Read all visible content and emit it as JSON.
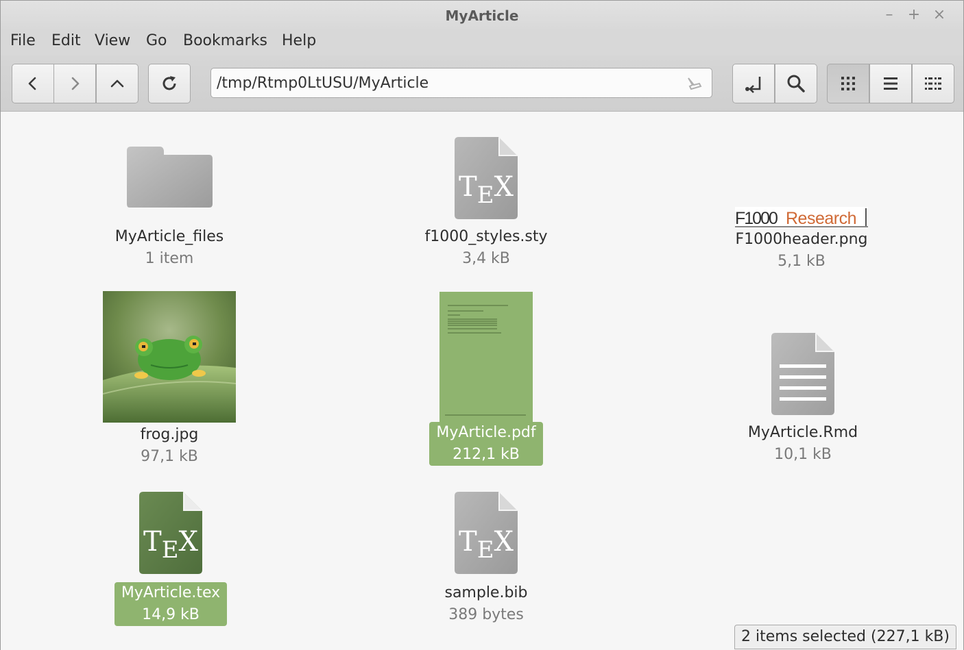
{
  "window": {
    "title": "MyArticle",
    "minimize_glyph": "–",
    "maximize_glyph": "+",
    "close_glyph": "×"
  },
  "menu": [
    "File",
    "Edit",
    "View",
    "Go",
    "Bookmarks",
    "Help"
  ],
  "location": {
    "path": "/tmp/Rtmp0LtUSU/MyArticle"
  },
  "colors": {
    "selection": "#8fb46f",
    "icon_gray": "#a8a8a8",
    "tex_selected": "#5b7b46"
  },
  "files": [
    {
      "name": "MyArticle_files",
      "detail": "1 item",
      "icon": "folder-icon",
      "selected": false
    },
    {
      "name": "f1000_styles.sty",
      "detail": "3,4 kB",
      "icon": "tex-file-icon",
      "selected": false
    },
    {
      "name": "F1000header.png",
      "detail": "5,1 kB",
      "icon": "image-thumbnail",
      "selected": false,
      "thumbnail_text": "F1000Research"
    },
    {
      "name": "frog.jpg",
      "detail": "97,1 kB",
      "icon": "image-thumbnail",
      "selected": false
    },
    {
      "name": "MyArticle.pdf",
      "detail": "212,1 kB",
      "icon": "pdf-thumbnail",
      "selected": true
    },
    {
      "name": "MyArticle.Rmd",
      "detail": "10,1 kB",
      "icon": "text-file-icon",
      "selected": false
    },
    {
      "name": "MyArticle.tex",
      "detail": "14,9 kB",
      "icon": "tex-file-icon",
      "selected": true
    },
    {
      "name": "sample.bib",
      "detail": "389 bytes",
      "icon": "tex-file-icon",
      "selected": false
    }
  ],
  "status": {
    "text": "2 items selected (227,1 kB)"
  }
}
